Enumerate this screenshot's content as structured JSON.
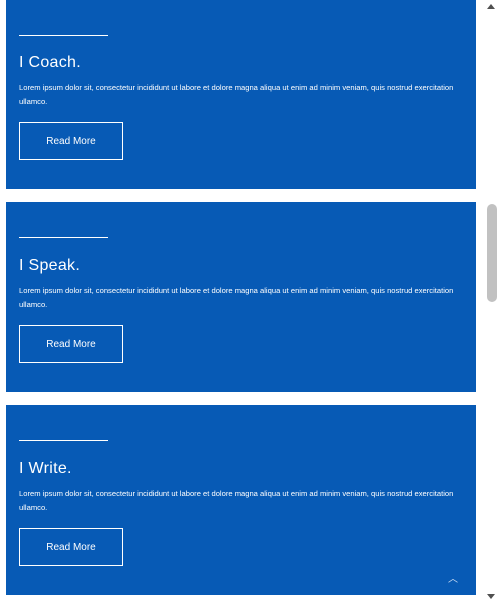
{
  "cards": [
    {
      "title": "I Coach.",
      "description": "Lorem ipsum dolor sit, consectetur incididunt ut labore et dolore magna aliqua ut enim ad minim veniam, quis nostrud exercitation ullamco.",
      "button": "Read More"
    },
    {
      "title": "I Speak.",
      "description": "Lorem ipsum dolor sit, consectetur incididunt ut labore et dolore magna aliqua ut enim ad minim veniam, quis nostrud exercitation ullamco.",
      "button": "Read More"
    },
    {
      "title": "I Write.",
      "description": "Lorem ipsum dolor sit, consectetur incididunt ut labore et dolore magna aliqua ut enim ad minim veniam, quis nostrud exercitation ullamco.",
      "button": "Read More"
    }
  ],
  "colors": {
    "card_background": "#075ab5",
    "text": "#ffffff"
  },
  "icons": {
    "back_to_top": "chevron-up-icon"
  }
}
